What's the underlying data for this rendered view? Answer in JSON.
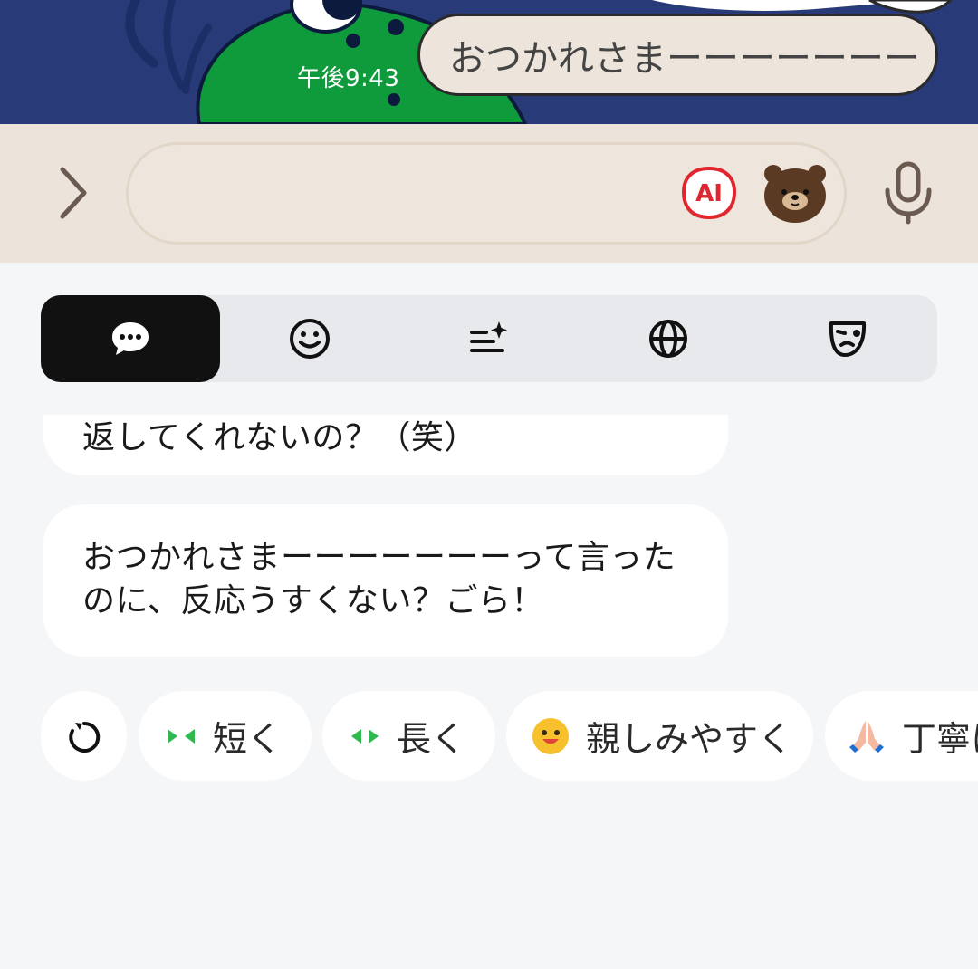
{
  "chat": {
    "timestamp": "午後9:43",
    "sent_message": "おつかれさまーーーーーーー"
  },
  "input": {
    "placeholder": "",
    "ai_label": "AI",
    "icons": [
      "chevron-right-icon",
      "ai-icon",
      "bear-sticker-icon",
      "mic-icon"
    ]
  },
  "tabs": [
    {
      "name": "reply",
      "icon": "chat-bubble-icon",
      "active": true
    },
    {
      "name": "emoji",
      "icon": "smiley-icon",
      "active": false
    },
    {
      "name": "rewrite",
      "icon": "list-sparkle-icon",
      "active": false
    },
    {
      "name": "translate",
      "icon": "globe-icon",
      "active": false
    },
    {
      "name": "other",
      "icon": "mask-icon",
      "active": false
    }
  ],
  "suggestions": [
    {
      "text": "返してくれないの？（笑）"
    },
    {
      "text": "おつかれさまーーーーーーーって言ったのに、反応うすくない？ごら！"
    }
  ],
  "chips": {
    "short": "短く",
    "long": "長く",
    "friendly": "親しみやすく",
    "polite": "丁寧に"
  },
  "colors": {
    "chat_bg": "#283a78",
    "input_bg": "#ece3da",
    "panel_bg": "#f5f6f8",
    "tab_active": "#111111",
    "ai_red": "#e0262e",
    "chip_green": "#2fb84f"
  }
}
